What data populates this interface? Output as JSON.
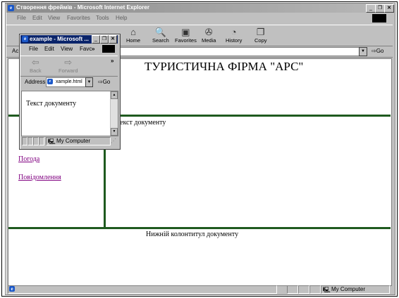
{
  "main_window": {
    "title": "Створення фреймів - Microsoft Internet Explorer",
    "menu": [
      "File",
      "Edit",
      "View",
      "Favorites",
      "Tools",
      "Help"
    ],
    "toolbar": [
      {
        "label": "Home",
        "icon": "home-icon"
      },
      {
        "label": "Search",
        "icon": "search-icon"
      },
      {
        "label": "Favorites",
        "icon": "favorites-icon"
      },
      {
        "label": "Media",
        "icon": "media-icon"
      },
      {
        "label": "History",
        "icon": "history-icon"
      },
      {
        "label": "Copy",
        "icon": "copy-icon"
      }
    ],
    "address_prefix": "Ac",
    "go_label": "Go",
    "status_zone": "My Computer"
  },
  "page": {
    "heading": "ТУРИСТИЧНА ФІРМА \"АРС\"",
    "main_text": "екст документу",
    "links": [
      "Погода",
      "Повідомлення"
    ],
    "footer": "Нижній колонтитул документу"
  },
  "popup": {
    "title": "example - Microsoft ...",
    "menu": [
      "File",
      "Edit",
      "View",
      "Favc"
    ],
    "menu_more": "»",
    "nav_back": "Back",
    "nav_forward": "Forward",
    "nav_more": "»",
    "address_label": "Address",
    "address_value": "xample.html",
    "go_label": "Go",
    "content_text": "Текст документу",
    "status_zone": "My Computer"
  }
}
